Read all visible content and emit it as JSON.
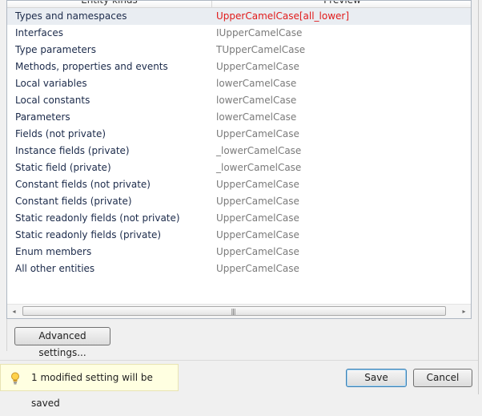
{
  "columns": {
    "kinds": "Entity kinds",
    "preview": "Preview"
  },
  "rows": [
    {
      "kind": "Types and namespaces",
      "preview": "UpperCamelCase[all_lower]",
      "selected": true,
      "error": true
    },
    {
      "kind": "Interfaces",
      "preview": "IUpperCamelCase"
    },
    {
      "kind": "Type parameters",
      "preview": "TUpperCamelCase"
    },
    {
      "kind": "Methods, properties and events",
      "preview": "UpperCamelCase"
    },
    {
      "kind": "Local variables",
      "preview": "lowerCamelCase"
    },
    {
      "kind": "Local constants",
      "preview": "lowerCamelCase"
    },
    {
      "kind": "Parameters",
      "preview": "lowerCamelCase"
    },
    {
      "kind": "Fields (not private)",
      "preview": "UpperCamelCase"
    },
    {
      "kind": "Instance fields (private)",
      "preview": "_lowerCamelCase"
    },
    {
      "kind": "Static field (private)",
      "preview": "_lowerCamelCase"
    },
    {
      "kind": "Constant fields (not private)",
      "preview": "UpperCamelCase"
    },
    {
      "kind": "Constant fields (private)",
      "preview": "UpperCamelCase"
    },
    {
      "kind": "Static readonly fields (not private)",
      "preview": "UpperCamelCase"
    },
    {
      "kind": "Static readonly fields (private)",
      "preview": "UpperCamelCase"
    },
    {
      "kind": "Enum members",
      "preview": "UpperCamelCase"
    },
    {
      "kind": "All other entities",
      "preview": "UpperCamelCase"
    }
  ],
  "scrollbar": {
    "left_arrow": "◂",
    "right_arrow": "▸",
    "grip": "|||"
  },
  "buttons": {
    "advanced": "Advanced settings...",
    "save": "Save",
    "cancel": "Cancel"
  },
  "notice": {
    "text": "1 modified setting will be saved",
    "icon": "lightbulb-icon"
  },
  "colors": {
    "error_text": "#e11b1b",
    "selected_row": "#e9edf2",
    "notice_bg": "#ffffe1"
  }
}
